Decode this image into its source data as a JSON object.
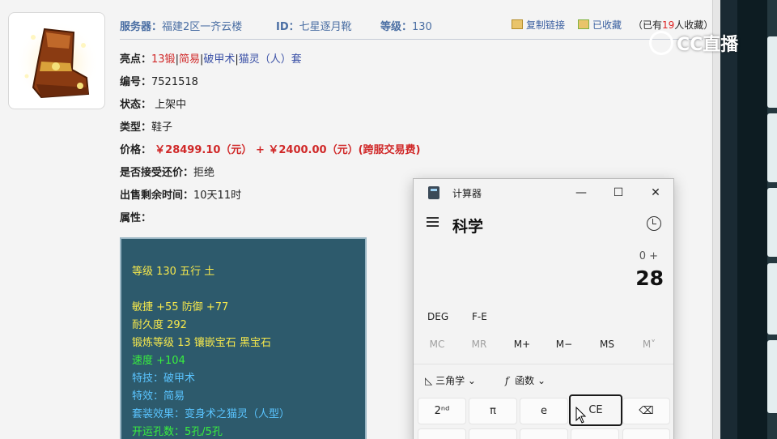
{
  "header": {
    "server_label": "服务器：",
    "server_value": "福建2区一齐云楼",
    "id_label": "ID：",
    "id_value": "七星逐月靴",
    "level_label": "等级：",
    "level_value": "130",
    "copy_link": "复制链接",
    "favorited": "已收藏",
    "count_prefix": "（已有",
    "count_num": "19",
    "count_suffix": "人收藏）"
  },
  "item": {
    "highlights_label": "亮点：",
    "highlight_1": "13锻",
    "sep": "|",
    "highlight_2": "简易",
    "highlight_3": "破甲术",
    "highlight_4": "猫灵（人）套",
    "number_label": "编号：",
    "number_value": "7521518",
    "status_label": "状态：",
    "status_value": "上架中",
    "type_label": "类型：",
    "type_value": "鞋子",
    "price_label": "价格：",
    "price_value": "￥28499.10（元） + ￥2400.00（元）(跨服交易费)",
    "bargain_label": "是否接受还价：",
    "bargain_value": "拒绝",
    "remaining_label": "出售剩余时间：",
    "remaining_value": "10天11时",
    "attr_label": "属性："
  },
  "attributes": {
    "line1": "等级 130 五行 土",
    "line2": "敏捷 +55 防御 +77",
    "line3": "耐久度 292",
    "line4": "锻炼等级 13 镶嵌宝石 黑宝石",
    "line5": "速度 +104",
    "line6": "特技：破甲术",
    "line7": "特效：简易",
    "line8": "套装效果：变身术之猫灵（人型）",
    "line9": "开运孔数：5孔/5孔"
  },
  "stream": {
    "logo_text": "CC直播"
  },
  "calculator": {
    "title": "计算器",
    "mode": "科学",
    "expression": "0 +",
    "display": "28",
    "deg": "DEG",
    "fe": "F-E",
    "memory": [
      "MC",
      "MR",
      "M+",
      "M−",
      "MS",
      "M˅"
    ],
    "trig": "三角学",
    "func": "函数",
    "keys_row1": [
      "2ⁿᵈ",
      "π",
      "e",
      "CE",
      "⌫"
    ],
    "win_minimize": "—",
    "win_maximize": "☐",
    "win_close": "✕"
  }
}
